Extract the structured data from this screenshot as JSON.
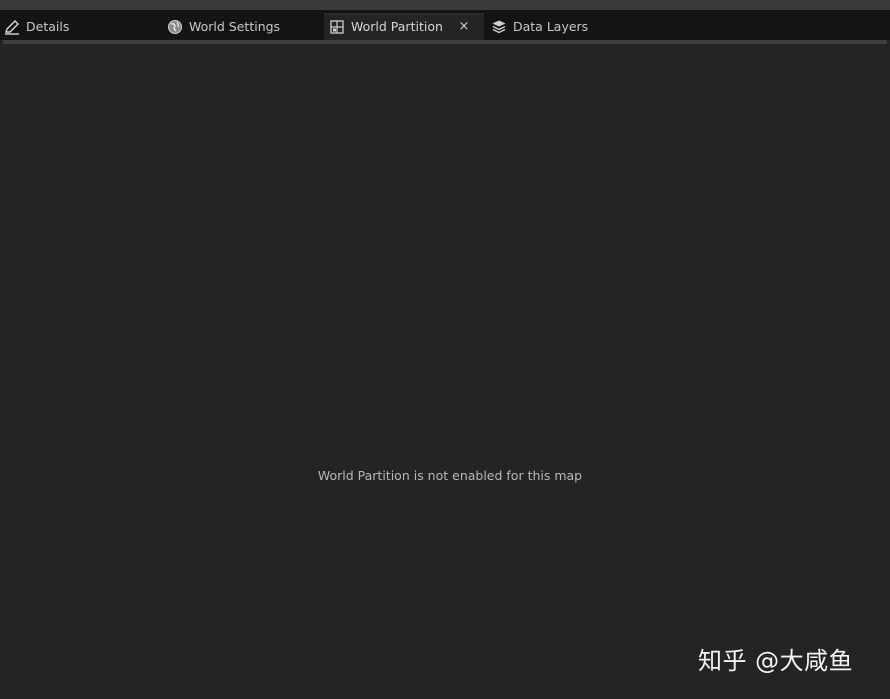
{
  "tabs": [
    {
      "label": "Details",
      "icon": "pencil-icon",
      "active": false
    },
    {
      "label": "World Settings",
      "icon": "globe-icon",
      "active": false
    },
    {
      "label": "World Partition",
      "icon": "grid-map-icon",
      "active": true,
      "close_label": "×"
    },
    {
      "label": "Data Layers",
      "icon": "layers-icon",
      "active": false
    }
  ],
  "panel": {
    "message": "World Partition is not enabled for this map"
  },
  "watermark": {
    "text": "知乎 @大咸鱼"
  },
  "colors": {
    "background": "#242424",
    "tabbar": "#141414",
    "text": "#c9c9c9"
  }
}
